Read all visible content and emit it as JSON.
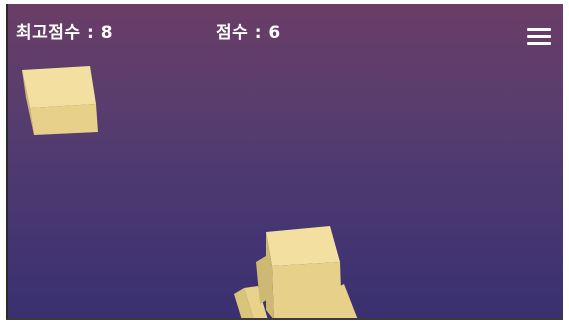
{
  "hud": {
    "best_score_label": "최고점수 : 8",
    "score_label": "점수 : 6"
  },
  "menu": {
    "icon": "hamburger-menu-icon"
  },
  "colors": {
    "background_top": "#6a3d66",
    "background_bottom": "#3a3070",
    "block_top": "#f3e0a0",
    "block_front": "#e6d08a",
    "block_side": "#cdb874",
    "text": "#ffffff"
  }
}
